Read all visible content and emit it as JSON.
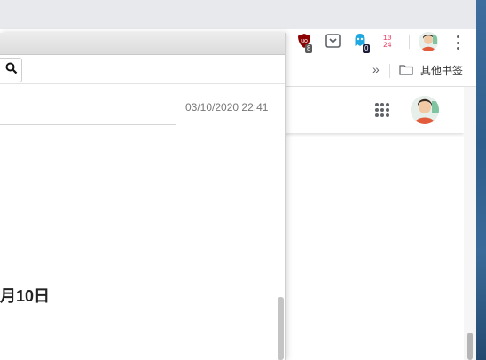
{
  "toolbar": {
    "ublock_badge": "8",
    "pocket_label": "",
    "ghostery_badge": "0",
    "ext_1024_text": "10\n24"
  },
  "bookmarks_bar": {
    "overflow_label": "»",
    "other_bookmarks_label": "其他书签"
  },
  "page": {
    "timestamp": "03/10/2020 22:41",
    "date_heading": "月10日"
  },
  "colors": {
    "chrome_bg": "#e8e9ec",
    "ublock_red": "#8b0000",
    "ghostery_blue": "#1fa8e0",
    "ext_1024_pink": "#e8335f"
  }
}
